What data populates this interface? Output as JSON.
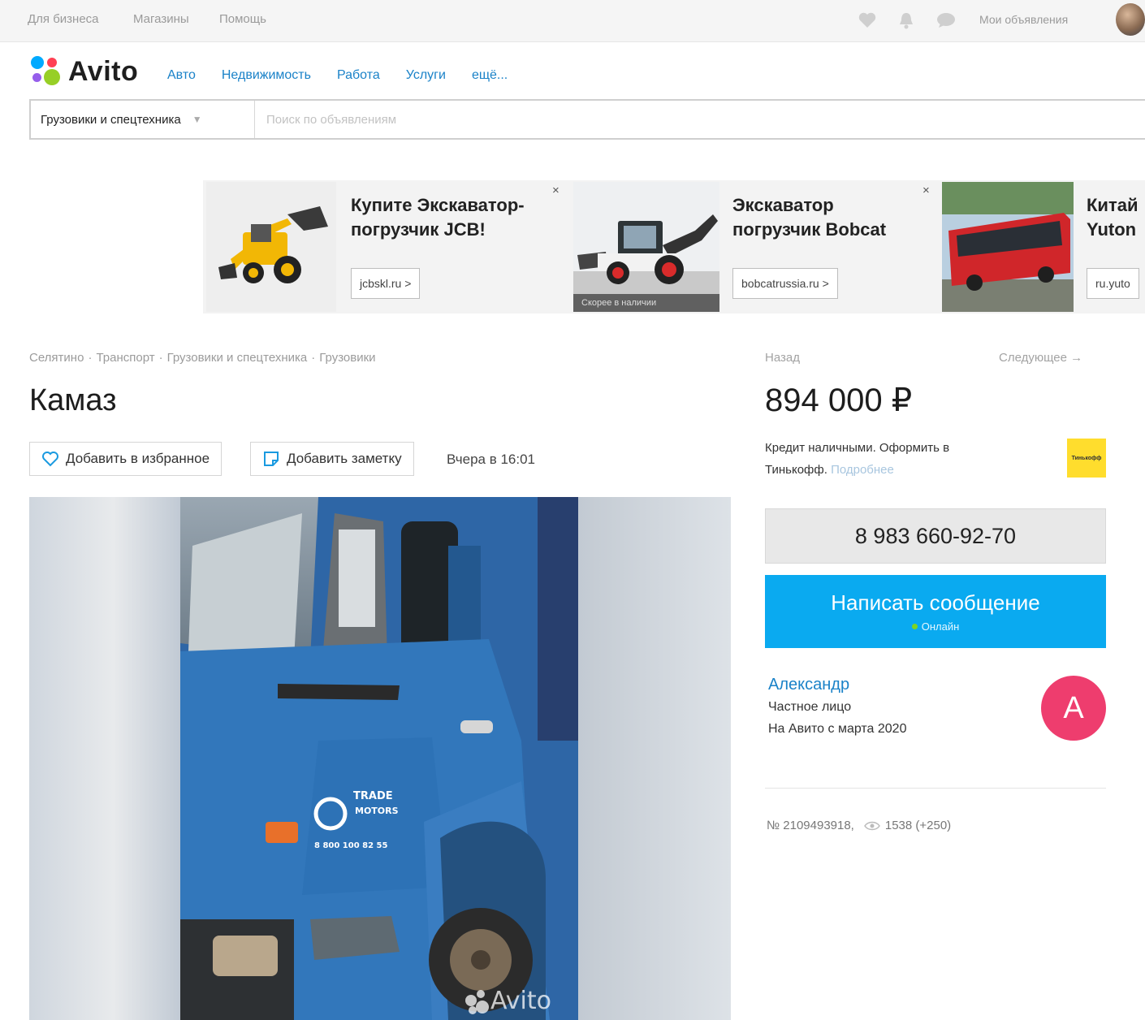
{
  "topbar": {
    "links": [
      "Для бизнеса",
      "Магазины",
      "Помощь"
    ],
    "icons": [
      "heart-icon",
      "bell-icon",
      "chat-icon"
    ],
    "my_ads": "Мои объявления"
  },
  "header": {
    "logo_text": "Avito",
    "nav": [
      "Авто",
      "Недвижимость",
      "Работа",
      "Услуги",
      "ещё..."
    ]
  },
  "search": {
    "category": "Грузовики и спецтехника",
    "placeholder": "Поиск по объявлениям"
  },
  "ads": [
    {
      "title_line1": "Купите Экскаватор-",
      "title_line2": "погрузчик JCB!",
      "button": "jcbskl.ru >",
      "close": "×"
    },
    {
      "title_line1": "Экскаватор",
      "title_line2": "погрузчик Bobcat",
      "button": "bobcatrussia.ru >",
      "close": "×",
      "caption": "Скорее в наличии"
    },
    {
      "title_line1": "Китай",
      "title_line2": "Yuton",
      "button": "ru.yuto"
    }
  ],
  "listing": {
    "breadcrumb": [
      "Селятино",
      "Транспорт",
      "Грузовики и спецтехника",
      "Грузовики"
    ],
    "title": "Камаз",
    "favorite_label": "Добавить в избранное",
    "note_label": "Добавить заметку",
    "posted": "Вчера в 16:01",
    "watermark": "Avito",
    "door_text_1": "TRADE",
    "door_text_2": "MOTORS",
    "door_phone": "8 800 100 82 55"
  },
  "sidebar": {
    "back": "Назад",
    "next": "Следующее →",
    "price": "894 000 ₽",
    "credit_text": "Кредит наличными. Оформить в Тинькофф.",
    "credit_more": "Подробнее",
    "tinkoff_label": "Тинькофф",
    "phone": "8 983 660-92-70",
    "message_label": "Написать сообщение",
    "online_label": "Онлайн",
    "seller_name": "Александр",
    "seller_type": "Частное лицо",
    "seller_since": "На Авито с марта 2020",
    "seller_initial": "А",
    "item_number": "№ 2109493918,",
    "views": "1538 (+250)"
  },
  "colors": {
    "link": "#1a82c8",
    "message_button": "#0aaaf0",
    "avatar": "#ee3d6e",
    "tinkoff": "#ffdd2d"
  }
}
